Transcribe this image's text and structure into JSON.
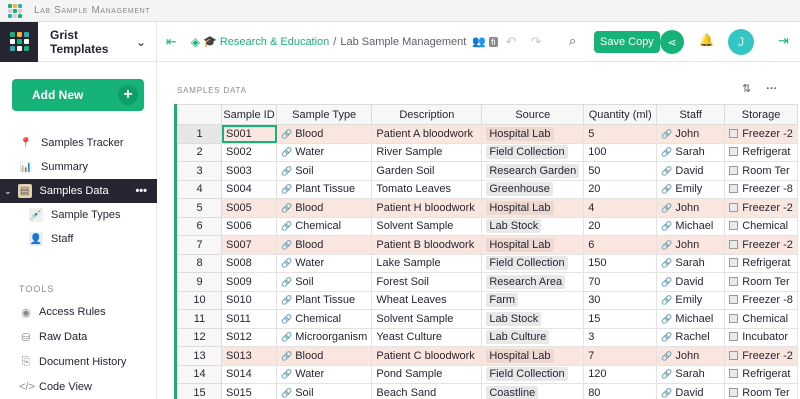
{
  "app": {
    "window_title": "Lab Sample Management"
  },
  "org": {
    "name": "Grist Templates"
  },
  "sidebar": {
    "add_new": "Add New",
    "pages": [
      {
        "label": "Samples Tracker",
        "icon": "pin-icon"
      },
      {
        "label": "Summary",
        "icon": "chart-icon"
      },
      {
        "label": "Samples Data",
        "icon": "table-icon"
      },
      {
        "label": "Sample Types",
        "icon": "syringe-icon"
      },
      {
        "label": "Staff",
        "icon": "person-icon"
      }
    ],
    "tools_heading": "TOOLS",
    "tools": [
      {
        "label": "Access Rules",
        "icon": "eye-icon"
      },
      {
        "label": "Raw Data",
        "icon": "database-icon"
      },
      {
        "label": "Document History",
        "icon": "history-icon"
      },
      {
        "label": "Code View",
        "icon": "code-icon"
      }
    ]
  },
  "topbar": {
    "workspace": "Research & Education",
    "separator": "/",
    "document": "Lab Sample Management",
    "save_copy": "Save Copy",
    "avatar_initial": "J"
  },
  "section": {
    "title": "SAMPLES DATA"
  },
  "table": {
    "columns": [
      "Sample ID",
      "Sample Type",
      "Description",
      "Source",
      "Quantity (ml)",
      "Staff",
      "Storage"
    ],
    "rows": [
      {
        "n": "1",
        "id": "S001",
        "type": "Blood",
        "desc": "Patient A bloodwork",
        "source": "Hospital Lab",
        "qty": "5",
        "staff": "John",
        "storage": "Freezer -2",
        "hl": true
      },
      {
        "n": "2",
        "id": "S002",
        "type": "Water",
        "desc": "River Sample",
        "source": "Field Collection",
        "qty": "100",
        "staff": "Sarah",
        "storage": "Refrigerat",
        "hl": false
      },
      {
        "n": "3",
        "id": "S003",
        "type": "Soil",
        "desc": "Garden Soil",
        "source": "Research Garden",
        "qty": "50",
        "staff": "David",
        "storage": "Room Ter",
        "hl": false
      },
      {
        "n": "4",
        "id": "S004",
        "type": "Plant Tissue",
        "desc": "Tomato Leaves",
        "source": "Greenhouse",
        "qty": "20",
        "staff": "Emily",
        "storage": "Freezer -8",
        "hl": false
      },
      {
        "n": "5",
        "id": "S005",
        "type": "Blood",
        "desc": "Patient H bloodwork",
        "source": "Hospital Lab",
        "qty": "4",
        "staff": "John",
        "storage": "Freezer -2",
        "hl": true
      },
      {
        "n": "6",
        "id": "S006",
        "type": "Chemical",
        "desc": "Solvent Sample",
        "source": "Lab Stock",
        "qty": "20",
        "staff": "Michael",
        "storage": "Chemical",
        "hl": false
      },
      {
        "n": "7",
        "id": "S007",
        "type": "Blood",
        "desc": "Patient B bloodwork",
        "source": "Hospital Lab",
        "qty": "6",
        "staff": "John",
        "storage": "Freezer -2",
        "hl": true
      },
      {
        "n": "8",
        "id": "S008",
        "type": "Water",
        "desc": "Lake Sample",
        "source": "Field Collection",
        "qty": "150",
        "staff": "Sarah",
        "storage": "Refrigerat",
        "hl": false
      },
      {
        "n": "9",
        "id": "S009",
        "type": "Soil",
        "desc": "Forest Soil",
        "source": "Research Area",
        "qty": "70",
        "staff": "David",
        "storage": "Room Ter",
        "hl": false
      },
      {
        "n": "10",
        "id": "S010",
        "type": "Plant Tissue",
        "desc": "Wheat Leaves",
        "source": "Farm",
        "qty": "30",
        "staff": "Emily",
        "storage": "Freezer -8",
        "hl": false
      },
      {
        "n": "11",
        "id": "S011",
        "type": "Chemical",
        "desc": "Solvent Sample",
        "source": "Lab Stock",
        "qty": "15",
        "staff": "Michael",
        "storage": "Chemical",
        "hl": false
      },
      {
        "n": "12",
        "id": "S012",
        "type": "Microorganism",
        "desc": "Yeast Culture",
        "source": "Lab Culture",
        "qty": "3",
        "staff": "Rachel",
        "storage": "Incubator",
        "hl": false
      },
      {
        "n": "13",
        "id": "S013",
        "type": "Blood",
        "desc": "Patient C bloodwork",
        "source": "Hospital Lab",
        "qty": "7",
        "staff": "John",
        "storage": "Freezer -2",
        "hl": true
      },
      {
        "n": "14",
        "id": "S014",
        "type": "Water",
        "desc": "Pond Sample",
        "source": "Field Collection",
        "qty": "120",
        "staff": "Sarah",
        "storage": "Refrigerat",
        "hl": false
      },
      {
        "n": "15",
        "id": "S015",
        "type": "Soil",
        "desc": "Beach Sand",
        "source": "Coastline",
        "qty": "80",
        "staff": "David",
        "storage": "Room Ter",
        "hl": false
      }
    ]
  },
  "colors": {
    "accent": "#16b378",
    "highlight_row": "#f9e7df",
    "dark_nav": "#262633"
  }
}
